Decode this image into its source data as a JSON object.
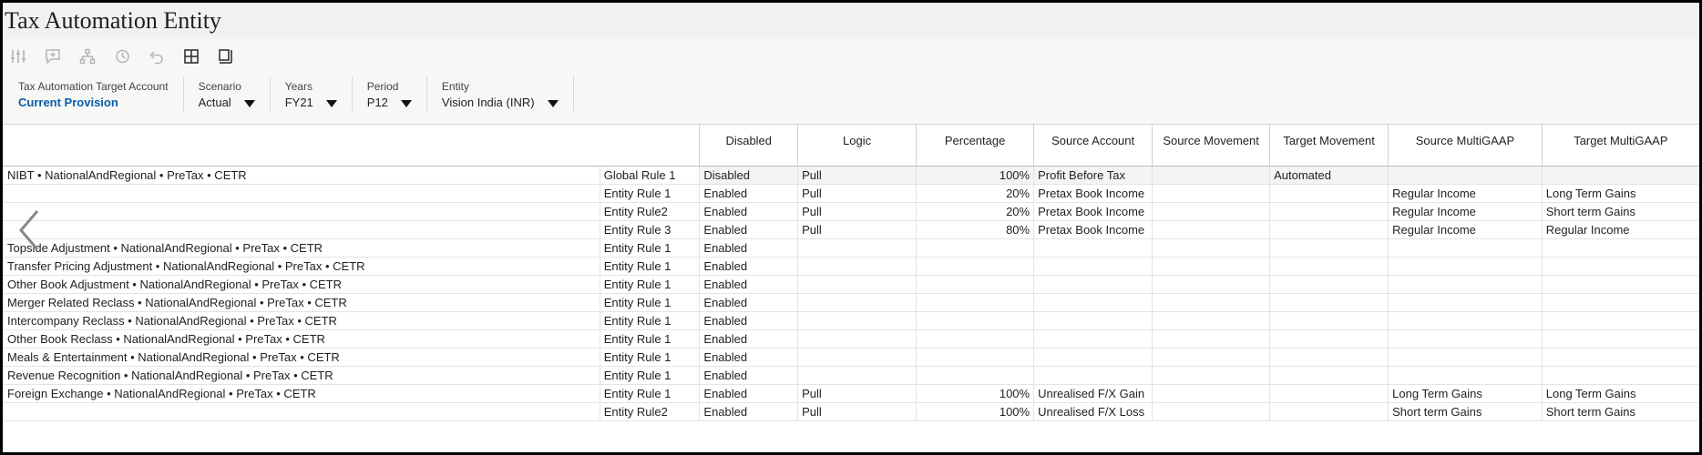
{
  "title": "Tax Automation Entity",
  "toolbar": {
    "icons": [
      "sliders-icon",
      "comment-icon",
      "hierarchy-icon",
      "history-icon",
      "undo-icon",
      "grid-icon",
      "panel-icon"
    ]
  },
  "pov": {
    "target_account": {
      "label": "Tax Automation Target Account",
      "value": "Current Provision"
    },
    "scenario": {
      "label": "Scenario",
      "value": "Actual"
    },
    "years": {
      "label": "Years",
      "value": "FY21"
    },
    "period": {
      "label": "Period",
      "value": "P12"
    },
    "entity": {
      "label": "Entity",
      "value": "Vision India (INR)"
    }
  },
  "grid": {
    "columns": [
      "Disabled",
      "Logic",
      "Percentage",
      "Source Account",
      "Source Movement",
      "Target Movement",
      "Source MultiGAAP",
      "Target MultiGAAP"
    ],
    "rows": [
      {
        "member": "NIBT •  NationalAndRegional •  PreTax •  CETR",
        "rule": "Global Rule 1",
        "disabled": "Disabled",
        "logic": "Pull",
        "percentage": "100%",
        "source_account": "Profit Before Tax",
        "source_movement": "",
        "target_movement": "Automated",
        "source_multigaap": "",
        "target_multigaap": ""
      },
      {
        "member": "",
        "rule": "Entity Rule 1",
        "disabled": "Enabled",
        "logic": "Pull",
        "percentage": "20%",
        "source_account": "Pretax Book Income",
        "source_movement": "",
        "target_movement": "",
        "source_multigaap": "Regular Income",
        "target_multigaap": "Long Term Gains"
      },
      {
        "member": "",
        "rule": "Entity Rule2",
        "disabled": "Enabled",
        "logic": "Pull",
        "percentage": "20%",
        "source_account": "Pretax Book Income",
        "source_movement": "",
        "target_movement": "",
        "source_multigaap": "Regular Income",
        "target_multigaap": "Short term Gains"
      },
      {
        "member": "",
        "rule": "Entity Rule 3",
        "disabled": "Enabled",
        "logic": "Pull",
        "percentage": "80%",
        "source_account": "Pretax Book Income",
        "source_movement": "",
        "target_movement": "",
        "source_multigaap": "Regular Income",
        "target_multigaap": "Regular Income"
      },
      {
        "member": "Topside Adjustment •  NationalAndRegional •  PreTax •  CETR",
        "rule": "Entity Rule 1",
        "disabled": "Enabled",
        "logic": "",
        "percentage": "",
        "source_account": "",
        "source_movement": "",
        "target_movement": "",
        "source_multigaap": "",
        "target_multigaap": ""
      },
      {
        "member": "Transfer Pricing Adjustment •  NationalAndRegional •  PreTax •  CETR",
        "rule": "Entity Rule 1",
        "disabled": "Enabled",
        "logic": "",
        "percentage": "",
        "source_account": "",
        "source_movement": "",
        "target_movement": "",
        "source_multigaap": "",
        "target_multigaap": ""
      },
      {
        "member": "Other Book Adjustment •  NationalAndRegional •  PreTax •  CETR",
        "rule": "Entity Rule 1",
        "disabled": "Enabled",
        "logic": "",
        "percentage": "",
        "source_account": "",
        "source_movement": "",
        "target_movement": "",
        "source_multigaap": "",
        "target_multigaap": ""
      },
      {
        "member": "Merger Related Reclass •  NationalAndRegional •  PreTax •  CETR",
        "rule": "Entity Rule 1",
        "disabled": "Enabled",
        "logic": "",
        "percentage": "",
        "source_account": "",
        "source_movement": "",
        "target_movement": "",
        "source_multigaap": "",
        "target_multigaap": ""
      },
      {
        "member": "Intercompany Reclass •  NationalAndRegional •  PreTax •  CETR",
        "rule": "Entity Rule 1",
        "disabled": "Enabled",
        "logic": "",
        "percentage": "",
        "source_account": "",
        "source_movement": "",
        "target_movement": "",
        "source_multigaap": "",
        "target_multigaap": ""
      },
      {
        "member": "Other Book Reclass •  NationalAndRegional •  PreTax •  CETR",
        "rule": "Entity Rule 1",
        "disabled": "Enabled",
        "logic": "",
        "percentage": "",
        "source_account": "",
        "source_movement": "",
        "target_movement": "",
        "source_multigaap": "",
        "target_multigaap": ""
      },
      {
        "member": "Meals & Entertainment •  NationalAndRegional •  PreTax •  CETR",
        "rule": "Entity Rule 1",
        "disabled": "Enabled",
        "logic": "",
        "percentage": "",
        "source_account": "",
        "source_movement": "",
        "target_movement": "",
        "source_multigaap": "",
        "target_multigaap": ""
      },
      {
        "member": "Revenue Recognition •  NationalAndRegional •  PreTax •  CETR",
        "rule": "Entity Rule 1",
        "disabled": "Enabled",
        "logic": "",
        "percentage": "",
        "source_account": "",
        "source_movement": "",
        "target_movement": "",
        "source_multigaap": "",
        "target_multigaap": ""
      },
      {
        "member": "Foreign Exchange •  NationalAndRegional •  PreTax •  CETR",
        "rule": "Entity Rule 1",
        "disabled": "Enabled",
        "logic": "Pull",
        "percentage": "100%",
        "source_account": "Unrealised F/X Gain",
        "source_movement": "",
        "target_movement": "",
        "source_multigaap": "Long Term Gains",
        "target_multigaap": "Long Term Gains"
      },
      {
        "member": "",
        "rule": "Entity Rule2",
        "disabled": "Enabled",
        "logic": "Pull",
        "percentage": "100%",
        "source_account": "Unrealised F/X Loss",
        "source_movement": "",
        "target_movement": "",
        "source_multigaap": "Short term Gains",
        "target_multigaap": "Short term Gains"
      }
    ]
  }
}
